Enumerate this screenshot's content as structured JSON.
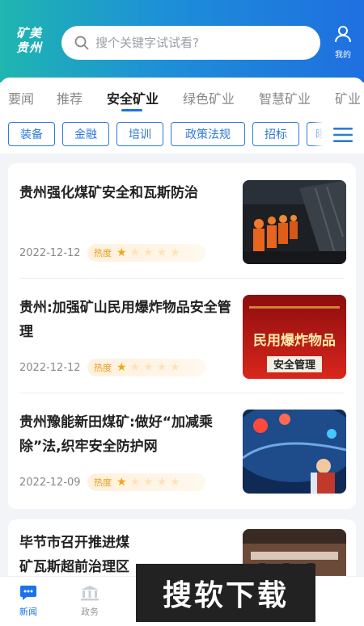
{
  "app": {
    "logo": "矿美 贵州"
  },
  "search": {
    "placeholder": "搜个关键字试试看?"
  },
  "profile": {
    "label": "我的"
  },
  "tabs": [
    {
      "label": "要闻",
      "active": false
    },
    {
      "label": "推荐",
      "active": false
    },
    {
      "label": "安全矿业",
      "active": true
    },
    {
      "label": "绿色矿业",
      "active": false
    },
    {
      "label": "智慧矿业",
      "active": false
    },
    {
      "label": "矿业",
      "active": false
    }
  ],
  "chips": [
    "装备",
    "金融",
    "培训",
    "政策法规",
    "招标",
    "曝"
  ],
  "articles": [
    {
      "title": "贵州强化煤矿安全和瓦斯防治",
      "date": "2022-12-12",
      "heat_label": "热度",
      "heat_stars": 1,
      "heat_max": 5,
      "thumb": "miners-in-tunnel"
    },
    {
      "title": "贵州:加强矿山民用爆炸物品安全管理",
      "date": "2022-12-12",
      "heat_label": "热度",
      "heat_stars": 1,
      "heat_max": 5,
      "thumb": "explosives-poster",
      "thumb_text": {
        "main": "民用爆炸物品",
        "sub": "安全管理"
      }
    },
    {
      "title": "贵州豫能新田煤矿:做好“加减乘除”法,织牢安全防护网",
      "date": "2022-12-09",
      "heat_label": "热度",
      "heat_stars": 1,
      "heat_max": 5,
      "thumb": "worker-in-tunnel"
    },
    {
      "title": "毕节市召开推进煤矿瓦斯超前治理区域 治理系统",
      "thumb": "meeting-room"
    }
  ],
  "bottom_nav": [
    {
      "label": "新闻",
      "icon": "chat-bubble-icon",
      "active": true
    },
    {
      "label": "政务",
      "icon": "government-building-icon",
      "active": false
    }
  ],
  "watermark": "搜软下载",
  "colors": {
    "accent": "#1a73e8",
    "chip_border": "#2f79d8",
    "star": "#f2a516",
    "header_start": "#1fb6b0",
    "header_end": "#1f6fe0"
  }
}
